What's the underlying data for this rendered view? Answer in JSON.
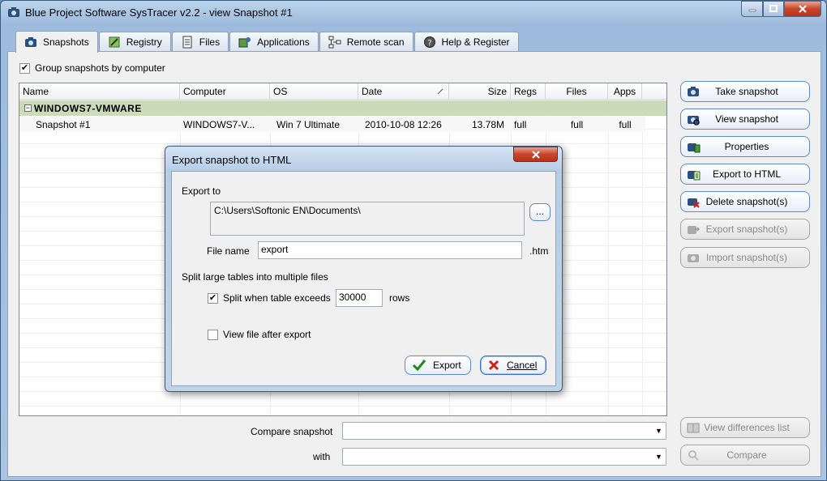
{
  "window": {
    "title": "Blue Project Software SysTracer v2.2 - view Snapshot #1"
  },
  "tabs": [
    {
      "label": "Snapshots",
      "icon": "camera-icon"
    },
    {
      "label": "Registry",
      "icon": "registry-icon"
    },
    {
      "label": "Files",
      "icon": "files-icon"
    },
    {
      "label": "Applications",
      "icon": "applications-icon"
    },
    {
      "label": "Remote scan",
      "icon": "network-icon"
    },
    {
      "label": "Help & Register",
      "icon": "help-icon"
    }
  ],
  "group_by_computer": {
    "label": "Group snapshots by computer",
    "checked": true
  },
  "list": {
    "columns": [
      "Name",
      "Computer",
      "OS",
      "Date",
      "Size",
      "Regs",
      "Files",
      "Apps"
    ],
    "group": "WINDOWS7-VMWARE",
    "rows": [
      {
        "name": "Snapshot #1",
        "computer": "WINDOWS7-V...",
        "os": "Win 7 Ultimate",
        "date": "2010-10-08 12:26",
        "size": "13.78M",
        "regs": "full",
        "files": "full",
        "apps": "full"
      }
    ]
  },
  "side_buttons": [
    {
      "label": "Take snapshot",
      "enabled": true
    },
    {
      "label": "View snapshot",
      "enabled": true
    },
    {
      "label": "Properties",
      "enabled": true
    },
    {
      "label": "Export to HTML",
      "enabled": true
    },
    {
      "label": "Delete snapshot(s)",
      "enabled": true
    },
    {
      "label": "Export snapshot(s)",
      "enabled": false
    },
    {
      "label": "Import snapshot(s)",
      "enabled": false
    }
  ],
  "compare": {
    "label": "Compare snapshot",
    "with_label": "with",
    "view_diff_label": "View differences list",
    "compare_label": "Compare"
  },
  "dialog": {
    "title": "Export snapshot to HTML",
    "export_to_label": "Export to",
    "path": "C:\\Users\\Softonic EN\\Documents\\",
    "browse_label": "...",
    "file_name_label": "File name",
    "file_name_value": "export",
    "extension": ".htm",
    "split_section_label": "Split large tables into multiple files",
    "split_label": "Split when table exceeds",
    "split_checked": true,
    "split_rows_value": "30000",
    "rows_label": "rows",
    "view_after_label": "View file after export",
    "view_after_checked": false,
    "export_button": "Export",
    "cancel_button": "Cancel"
  },
  "colors": {
    "group_row": "#c9dbb9",
    "button_border": "#5c8ad0",
    "close_red": "#c7442a"
  }
}
